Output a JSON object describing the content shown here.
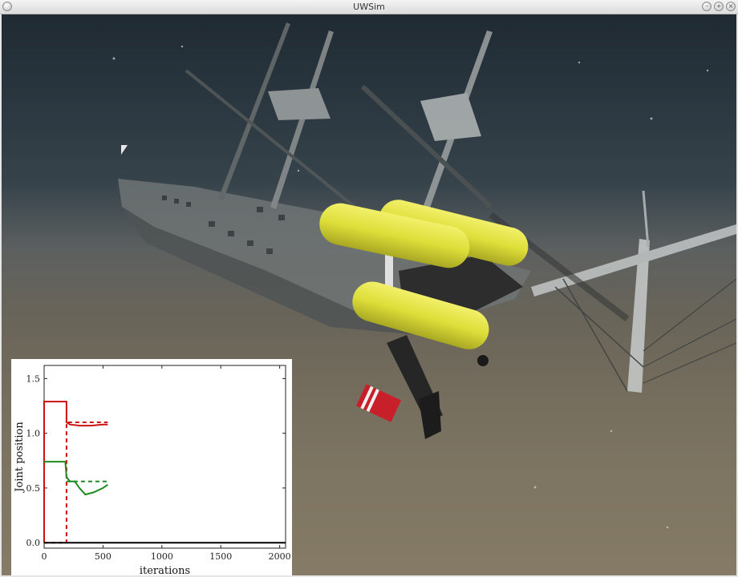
{
  "window": {
    "title": "UWSim"
  },
  "icons": {
    "app": "window-menu-icon",
    "minimize": "minimize-icon",
    "maximize": "maximize-icon",
    "close": "close-icon"
  },
  "colors": {
    "yellow_float": "#e3e238",
    "series_red": "#cc1111",
    "series_green": "#1f8a1f"
  },
  "chart_data": {
    "type": "line",
    "xlabel": "iterations",
    "ylabel": "Joint position",
    "xlim": [
      0,
      2050
    ],
    "ylim": [
      -0.05,
      1.62
    ],
    "xticks": [
      0,
      500,
      1000,
      1500,
      2000
    ],
    "yticks": [
      0.0,
      0.5,
      1.0,
      1.5
    ],
    "x_tick_labels": [
      "0",
      "500",
      "1000",
      "1500",
      "2000"
    ],
    "y_tick_labels": [
      "0.0",
      "0.5",
      "1.0",
      "1.5"
    ],
    "series": [
      {
        "color": "#cc1111",
        "style": "solid",
        "x": [
          0,
          0,
          190,
          190,
          220,
          300,
          400,
          500,
          540
        ],
        "y": [
          0.0,
          1.29,
          1.29,
          1.1,
          1.08,
          1.07,
          1.07,
          1.08,
          1.08
        ]
      },
      {
        "color": "#cc1111",
        "style": "dashed",
        "x": [
          0,
          190,
          190,
          540
        ],
        "y": [
          0.0,
          0.0,
          1.1,
          1.1
        ]
      },
      {
        "color": "#1f8a1f",
        "style": "solid",
        "x": [
          0,
          180,
          190,
          220,
          260,
          300,
          350,
          420,
          500,
          540
        ],
        "y": [
          0.74,
          0.74,
          0.6,
          0.56,
          0.56,
          0.5,
          0.44,
          0.46,
          0.5,
          0.53
        ]
      },
      {
        "color": "#1f8a1f",
        "style": "dashed",
        "x": [
          190,
          540
        ],
        "y": [
          0.56,
          0.56
        ]
      },
      {
        "color": "#000000",
        "style": "solid",
        "x": [
          0,
          2050
        ],
        "y": [
          0.0,
          0.0
        ]
      }
    ],
    "grid": false,
    "legend": "none"
  }
}
